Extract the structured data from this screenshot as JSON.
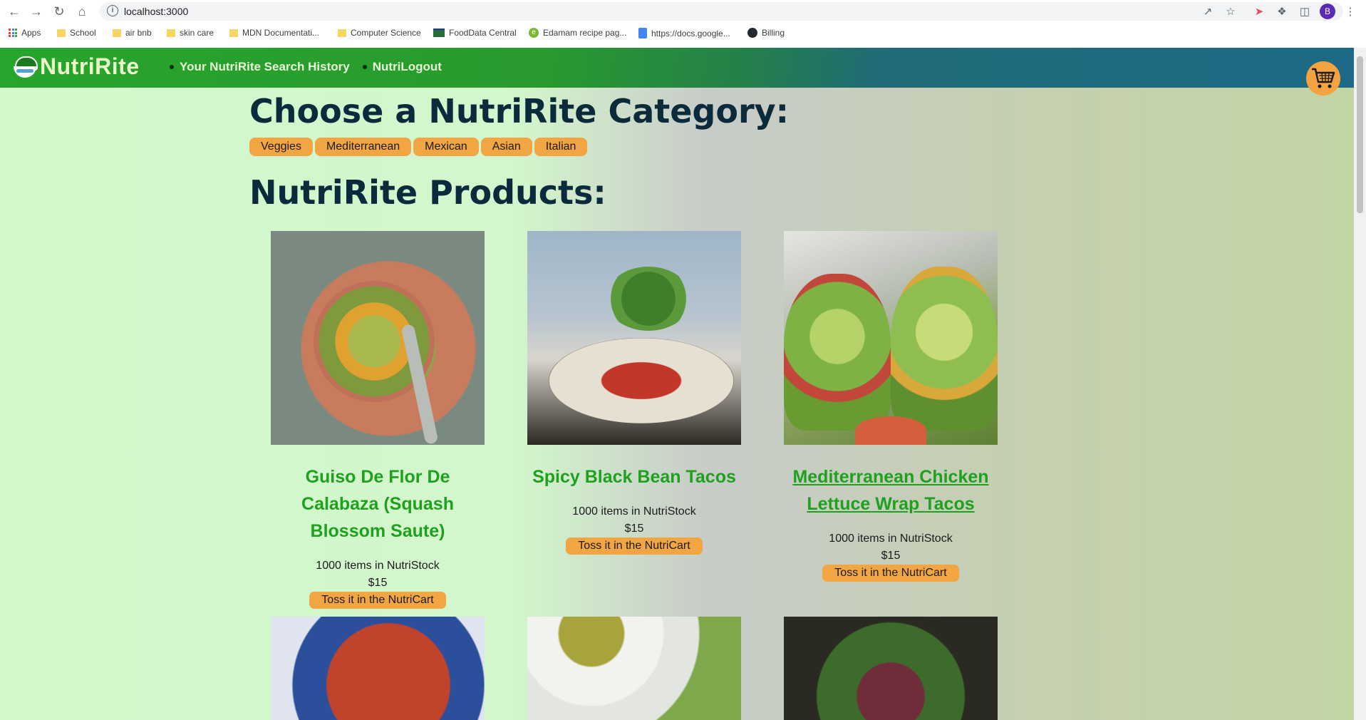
{
  "browser": {
    "url": "localhost:3000",
    "profile_initial": "B",
    "bookmarks": [
      {
        "label": "Apps",
        "icon": "apps-grid-icon"
      },
      {
        "label": "School",
        "icon": "folder-icon"
      },
      {
        "label": "air bnb",
        "icon": "folder-icon"
      },
      {
        "label": "skin care",
        "icon": "folder-icon"
      },
      {
        "label": "MDN Documentati...",
        "icon": "folder-icon"
      },
      {
        "label": "Computer Science",
        "icon": "folder-icon"
      },
      {
        "label": "FoodData Central",
        "icon": "usda-icon"
      },
      {
        "label": "Edamam recipe pag...",
        "icon": "edamam-icon"
      },
      {
        "label": "https://docs.google...",
        "icon": "google-docs-icon"
      },
      {
        "label": "Billing",
        "icon": "github-icon"
      }
    ]
  },
  "nav": {
    "brand": "NutriRite",
    "links": [
      "Your NutriRite Search History",
      "NutriLogout"
    ]
  },
  "categories": {
    "heading": "Choose a NutriRite Category:",
    "items": [
      "Veggies",
      "Mediterranean",
      "Mexican",
      "Asian",
      "Italian"
    ]
  },
  "products": {
    "heading": "NutriRite Products:",
    "add_label": "Toss it in the NutriCart",
    "items": [
      {
        "name": "Guiso De Flor De Calabaza (Squash Blossom Saute)",
        "stock": "1000 items in NutriStock",
        "price": "$15"
      },
      {
        "name": "Spicy Black Bean Tacos",
        "stock": "1000 items in NutriStock",
        "price": "$15"
      },
      {
        "name": "Mediterranean Chicken Lettuce Wrap Tacos",
        "stock": "1000 items in NutriStock",
        "price": "$15"
      }
    ]
  },
  "colors": {
    "accent": "#f1a543",
    "product_name": "#1fa11f",
    "heading": "#0b2b3c"
  }
}
